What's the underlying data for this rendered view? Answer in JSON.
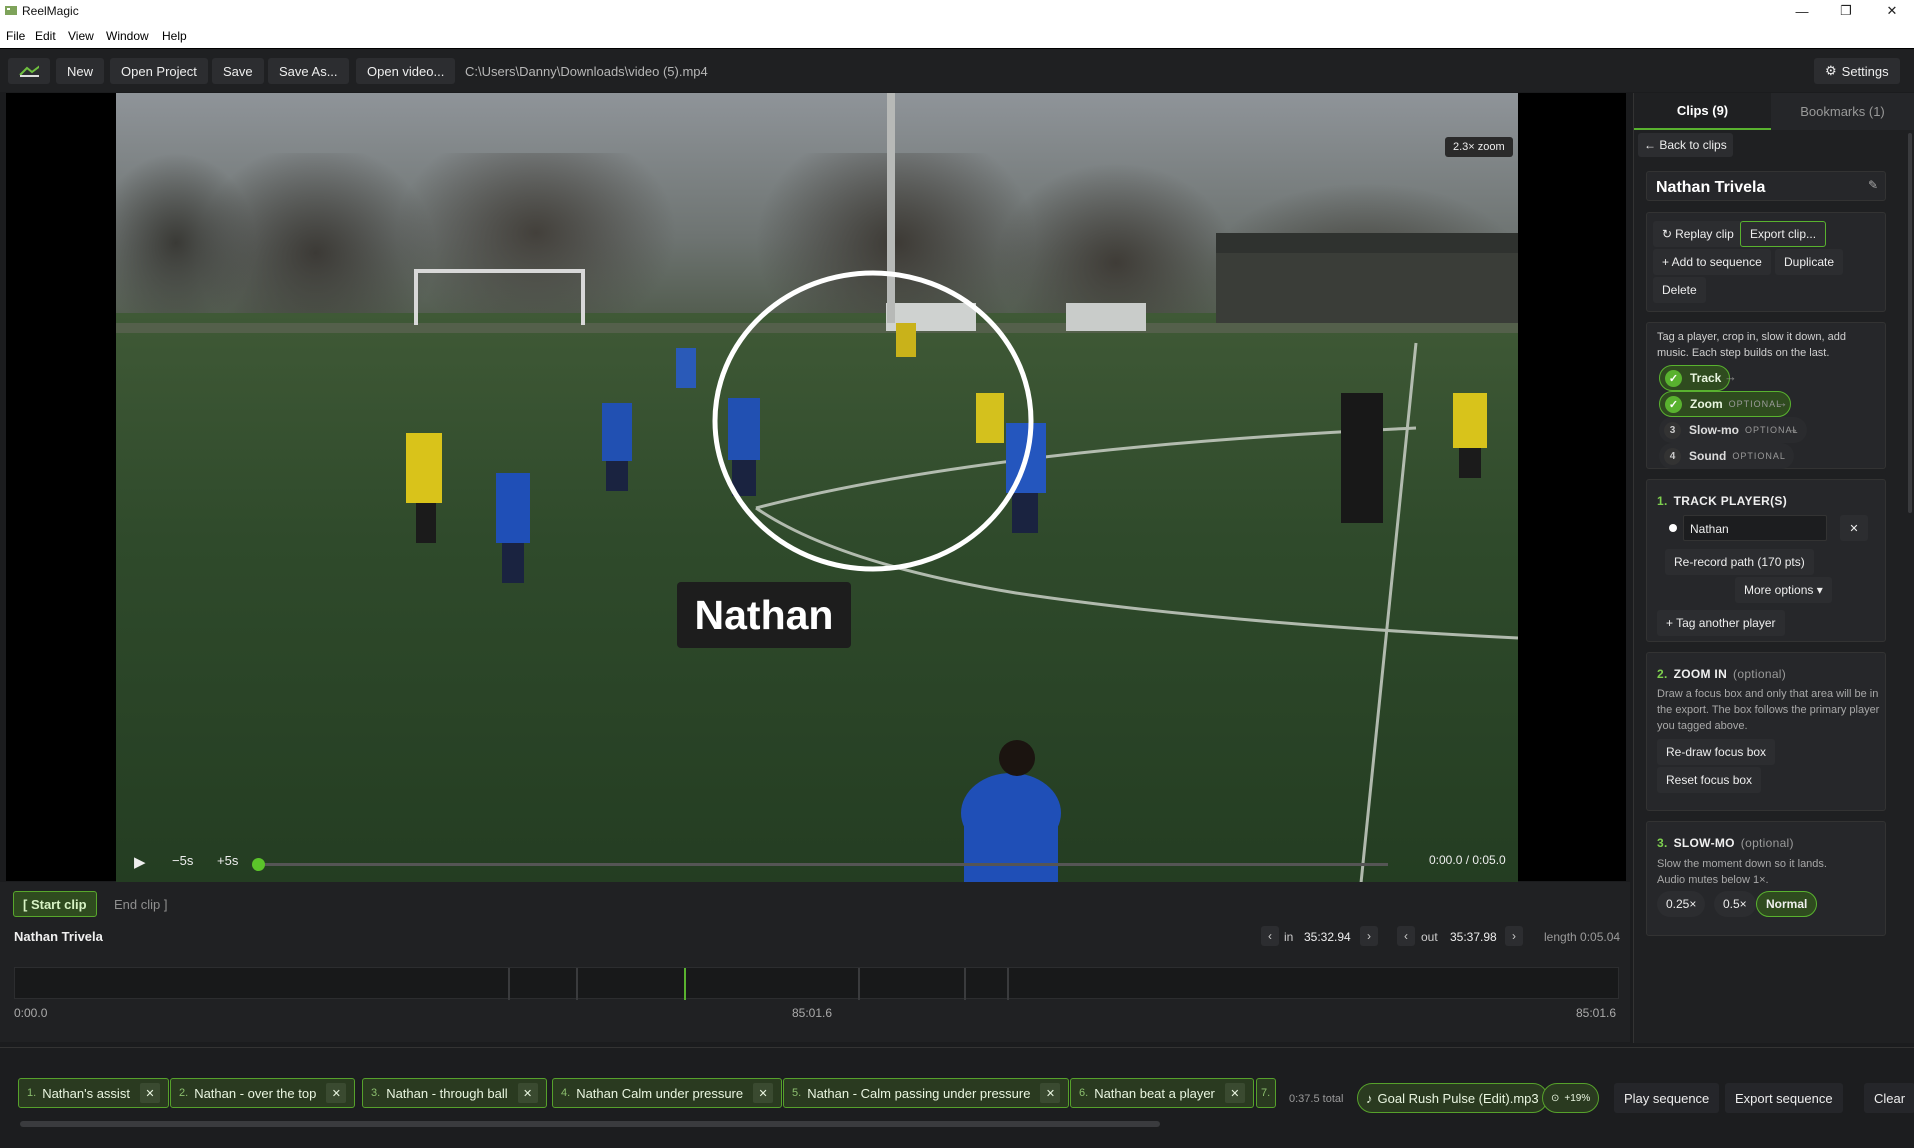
{
  "app": {
    "title": "ReelMagic",
    "menu": [
      "File",
      "Edit",
      "View",
      "Window",
      "Help"
    ]
  },
  "toolbar": {
    "new": "New",
    "open_project": "Open Project",
    "save": "Save",
    "save_as": "Save As...",
    "open_video": "Open video...",
    "file_path": "C:\\Users\\Danny\\Downloads\\video (5).mp4",
    "settings": "Settings"
  },
  "video": {
    "zoom_badge": "2.3× zoom",
    "player_tag": "Nathan",
    "back5": "−5s",
    "fwd5": "+5s",
    "time": "0:00.0 / 0:05.0",
    "playhead_fraction": 0
  },
  "clip_editor": {
    "start_clip": "[ Start clip",
    "end_clip": "End clip ]",
    "clip_name": "Nathan Trivela",
    "in_label": "in",
    "in_value": "35:32.94",
    "out_label": "out",
    "out_value": "35:37.98",
    "length": "length 0:05.04",
    "t_start": "0:00.0",
    "t_mid": "85:01.6",
    "t_end": "85:01.6"
  },
  "sequence": {
    "clips": [
      {
        "num": "1.",
        "label": "Nathan's assist"
      },
      {
        "num": "2.",
        "label": "Nathan - over the top"
      },
      {
        "num": "3.",
        "label": "Nathan - through ball"
      },
      {
        "num": "4.",
        "label": "Nathan Calm under pressure"
      },
      {
        "num": "5.",
        "label": "Nathan - Calm passing under pressure"
      },
      {
        "num": "6.",
        "label": "Nathan beat a player"
      },
      {
        "num": "7.",
        "label": ""
      }
    ],
    "total": "0:37.5 total",
    "music": "Goal Rush Pulse (Edit).mp3",
    "volume": "+19%",
    "play": "Play sequence",
    "export": "Export sequence",
    "clear": "Clear"
  },
  "panel": {
    "tab_clips": "Clips (9)",
    "tab_bookmarks": "Bookmarks (1)",
    "back": "← Back to clips",
    "clip_title": "Nathan Trivela",
    "replay": "Replay clip",
    "export_clip": "Export clip...",
    "add_seq": "+ Add to sequence",
    "duplicate": "Duplicate",
    "delete": "Delete",
    "intro": "Tag a player, crop in, slow it down, add music. Each step builds on the last.",
    "steps": [
      {
        "num": "1",
        "label": "Track",
        "optional": ""
      },
      {
        "num": "2",
        "label": "Zoom",
        "optional": "OPTIONAL"
      },
      {
        "num": "3",
        "label": "Slow-mo",
        "optional": "OPTIONAL"
      },
      {
        "num": "4",
        "label": "Sound",
        "optional": "OPTIONAL"
      }
    ],
    "track": {
      "num": "1.",
      "title": "TRACK PLAYER(S)",
      "player": "Nathan",
      "rerecord": "Re-record path (170 pts)",
      "more": "More options ▾",
      "tag_another": "+ Tag another player"
    },
    "zoom": {
      "num": "2.",
      "title": "ZOOM IN",
      "optional": "(optional)",
      "desc": "Draw a focus box and only that area will be in the export. The box follows the primary player you tagged above.",
      "redraw": "Re-draw focus box",
      "reset": "Reset focus box"
    },
    "slowmo": {
      "num": "3.",
      "title": "SLOW-MO",
      "optional": "(optional)",
      "desc": "Slow the moment down so it lands. Audio mutes below 1×.",
      "speeds": [
        "0.25×",
        "0.5×",
        "Normal"
      ]
    }
  }
}
